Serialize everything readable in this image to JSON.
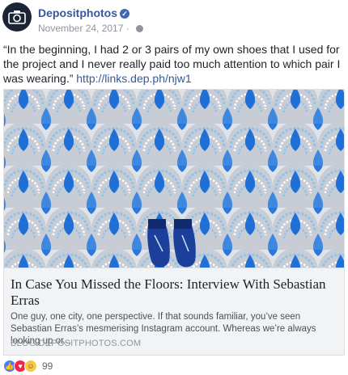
{
  "post": {
    "author": "Depositphotos",
    "date": "November 24, 2017",
    "separator": "·",
    "text": "“In the beginning, I had 2 or 3 pairs of my own shoes that I used for the project and I never really paid too much attention to which pair I was wearing.”",
    "link_text": "http://links.dep.ph/njw1"
  },
  "link_card": {
    "title": "In Case You Missed the Floors: Interview With Sebastian Erras",
    "description": "One guy, one city, one perspective. If that sounds familiar, you’ve seen Sebastian Erras’s mesmerising Instagram account. Whereas we’re always looking up or...",
    "domain": "BLOG.DEPOSITPHOTOS.COM"
  },
  "reactions": {
    "count": "99",
    "types": [
      "like-icon",
      "love-icon",
      "haha-icon"
    ]
  },
  "colors": {
    "link_blue": "#365899",
    "tile_blue": "#1f6fd6",
    "tile_light_blue": "#7db8e8",
    "tile_grey": "#b8bcc4"
  }
}
